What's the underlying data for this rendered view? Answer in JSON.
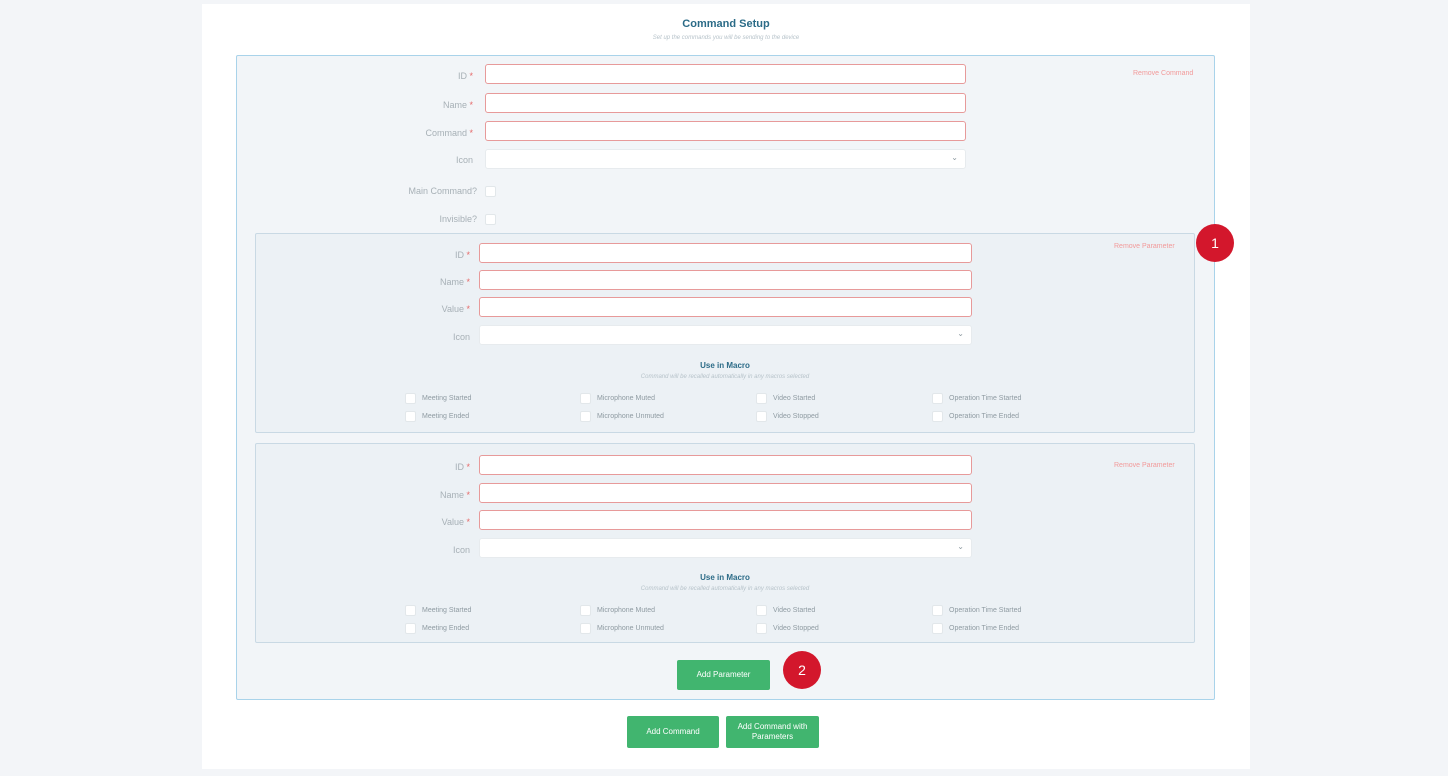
{
  "header": {
    "title": "Command Setup",
    "subtitle": "Set up the commands you will be sending to the device"
  },
  "command": {
    "remove_label": "Remove Command",
    "fields": {
      "id_label": "ID",
      "name_label": "Name",
      "command_label": "Command",
      "icon_label": "Icon",
      "main_command_label": "Main Command?",
      "invisible_label": "Invisible?"
    },
    "required_mark": "*"
  },
  "parameters": [
    {
      "remove_label": "Remove Parameter",
      "id_label": "ID",
      "name_label": "Name",
      "value_label": "Value",
      "icon_label": "Icon",
      "macro_title": "Use in Macro",
      "macro_subtitle": "Command will be recalled automatically in any macros selected",
      "options": [
        "Meeting Started",
        "Microphone Muted",
        "Video Started",
        "Operation Time Started",
        "Meeting Ended",
        "Microphone Unmuted",
        "Video Stopped",
        "Operation Time Ended"
      ]
    },
    {
      "remove_label": "Remove Parameter",
      "id_label": "ID",
      "name_label": "Name",
      "value_label": "Value",
      "icon_label": "Icon",
      "macro_title": "Use in Macro",
      "macro_subtitle": "Command will be recalled automatically in any macros selected",
      "options": [
        "Meeting Started",
        "Microphone Muted",
        "Video Started",
        "Operation Time Started",
        "Meeting Ended",
        "Microphone Unmuted",
        "Video Stopped",
        "Operation Time Ended"
      ]
    }
  ],
  "buttons": {
    "add_parameter": "Add Parameter",
    "add_command": "Add Command",
    "add_command_params": "Add Command with Parameters"
  },
  "badges": [
    "1",
    "2"
  ],
  "colors": {
    "accent_green": "#41b56f",
    "title_blue": "#2b6b87",
    "badge_red": "#d3172c",
    "required_red": "#e66a6a"
  }
}
